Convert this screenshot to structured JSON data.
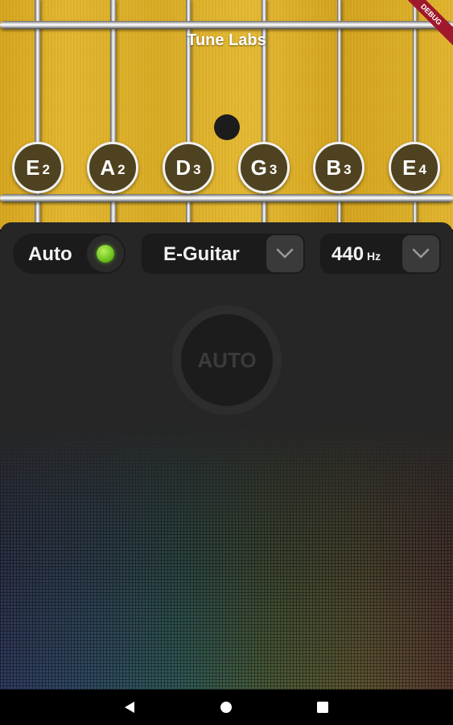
{
  "app": {
    "title": "Tune Labs",
    "debug_banner": "DEBUG"
  },
  "strings": [
    {
      "note": "E",
      "octave": "2"
    },
    {
      "note": "A",
      "octave": "2"
    },
    {
      "note": "D",
      "octave": "3"
    },
    {
      "note": "G",
      "octave": "3"
    },
    {
      "note": "B",
      "octave": "3"
    },
    {
      "note": "E",
      "octave": "4"
    }
  ],
  "controls": {
    "mode_label": "Auto",
    "mode_indicator_color": "#6cc21a",
    "instrument_value": "E-Guitar",
    "frequency_value": "440",
    "frequency_unit": "Hz"
  },
  "dial": {
    "label": "AUTO"
  },
  "navbar": {
    "back_icon": "back-icon",
    "home_icon": "home-icon",
    "recents_icon": "recents-icon"
  }
}
